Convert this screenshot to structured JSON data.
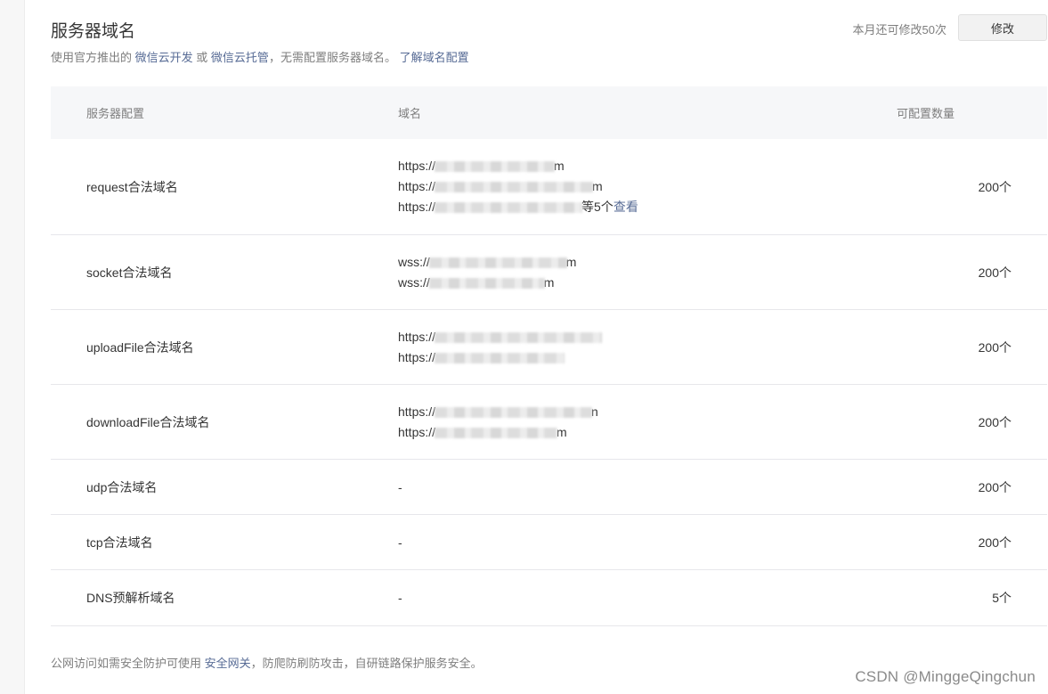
{
  "header": {
    "title": "服务器域名",
    "subtitle_prefix": "使用官方推出的",
    "link_cloudbase": "微信云开发",
    "subtitle_or": "或",
    "link_cloudhost": "微信云托管",
    "subtitle_suffix": "，无需配置服务器域名。",
    "link_learn": "了解域名配置",
    "quota_text": "本月还可修改50次",
    "modify_label": "修改"
  },
  "table": {
    "columns": [
      "服务器配置",
      "域名",
      "可配置数量"
    ],
    "rows": [
      {
        "name": "request合法域名",
        "domains": [
          "https://",
          "https://",
          "https://"
        ],
        "endings": [
          "m",
          "m",
          ""
        ],
        "more_text": "等5个",
        "more_link": "查看",
        "count": "200个"
      },
      {
        "name": "socket合法域名",
        "domains": [
          "wss://",
          "wss://"
        ],
        "endings": [
          "m",
          "m"
        ],
        "count": "200个"
      },
      {
        "name": "uploadFile合法域名",
        "domains": [
          "https://",
          "https://"
        ],
        "endings": [
          "",
          ""
        ],
        "count": "200个"
      },
      {
        "name": "downloadFile合法域名",
        "domains": [
          "https://",
          "https://"
        ],
        "endings": [
          "n",
          "m"
        ],
        "count": "200个"
      },
      {
        "name": "udp合法域名",
        "empty": "-",
        "count": "200个"
      },
      {
        "name": "tcp合法域名",
        "empty": "-",
        "count": "200个"
      },
      {
        "name": "DNS预解析域名",
        "empty": "-",
        "count": "5个"
      }
    ]
  },
  "footer": {
    "prefix": "公网访问如需安全防护可使用",
    "link_gateway": "安全网关",
    "suffix": "，防爬防刷防攻击，自研链路保护服务安全。"
  },
  "watermark": "CSDN @MinggeQingchun",
  "colors": {
    "link": "#576b95",
    "header_bg": "#f6f7f9",
    "muted": "#7e7e7e"
  }
}
